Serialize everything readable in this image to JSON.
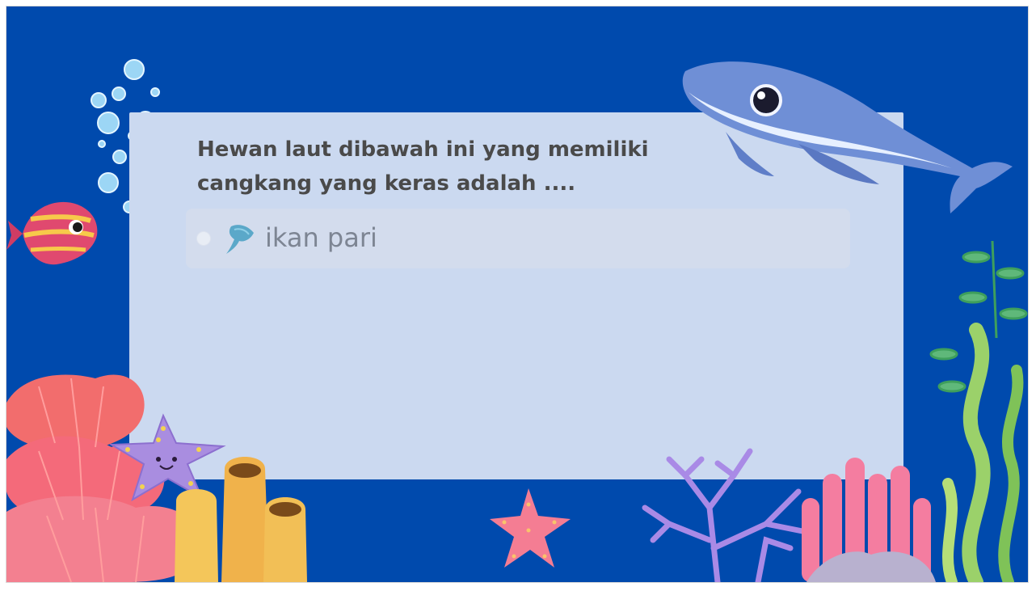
{
  "question": {
    "text": "Hewan laut dibawah ini yang memiliki cangkang yang keras adalah ...."
  },
  "options": [
    {
      "label": "ikan pari",
      "icon": "stingray-icon",
      "selected": false
    }
  ],
  "colors": {
    "background": "#004aad",
    "card": "#cbd9f0",
    "option": "#d3dced",
    "question_text": "#4a4a4a",
    "option_text": "#7d8593"
  },
  "decorations": [
    "bubbles-icon",
    "whale-icon",
    "fish-icon",
    "coral-icon",
    "starfish-icon",
    "tube-sponge-icon",
    "branch-coral-icon",
    "seaweed-icon"
  ]
}
